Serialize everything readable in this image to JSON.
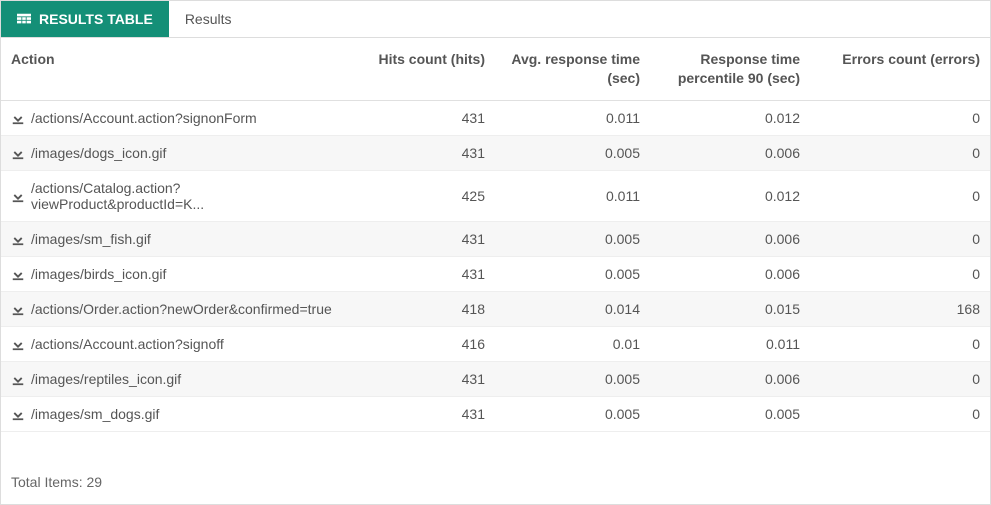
{
  "tabs": [
    {
      "label": "RESULTS TABLE",
      "icon": "table",
      "active": true
    },
    {
      "label": "Results",
      "icon": null,
      "active": false
    }
  ],
  "columns": {
    "action": "Action",
    "hits": "Hits count (hits)",
    "avg": "Avg. response time (sec)",
    "p90": "Response time percentile 90 (sec)",
    "errors": "Errors count (errors)"
  },
  "rows": [
    {
      "action": "/actions/Account.action?signonForm",
      "hits": "431",
      "avg": "0.011",
      "p90": "0.012",
      "errors": "0"
    },
    {
      "action": "/images/dogs_icon.gif",
      "hits": "431",
      "avg": "0.005",
      "p90": "0.006",
      "errors": "0"
    },
    {
      "action": "/actions/Catalog.action?viewProduct&productId=K...",
      "hits": "425",
      "avg": "0.011",
      "p90": "0.012",
      "errors": "0"
    },
    {
      "action": "/images/sm_fish.gif",
      "hits": "431",
      "avg": "0.005",
      "p90": "0.006",
      "errors": "0"
    },
    {
      "action": "/images/birds_icon.gif",
      "hits": "431",
      "avg": "0.005",
      "p90": "0.006",
      "errors": "0"
    },
    {
      "action": "/actions/Order.action?newOrder&confirmed=true",
      "hits": "418",
      "avg": "0.014",
      "p90": "0.015",
      "errors": "168"
    },
    {
      "action": "/actions/Account.action?signoff",
      "hits": "416",
      "avg": "0.01",
      "p90": "0.011",
      "errors": "0"
    },
    {
      "action": "/images/reptiles_icon.gif",
      "hits": "431",
      "avg": "0.005",
      "p90": "0.006",
      "errors": "0"
    },
    {
      "action": "/images/sm_dogs.gif",
      "hits": "431",
      "avg": "0.005",
      "p90": "0.005",
      "errors": "0"
    }
  ],
  "footer": {
    "totalItemsLabel": "Total Items:",
    "totalItemsValue": "29"
  }
}
